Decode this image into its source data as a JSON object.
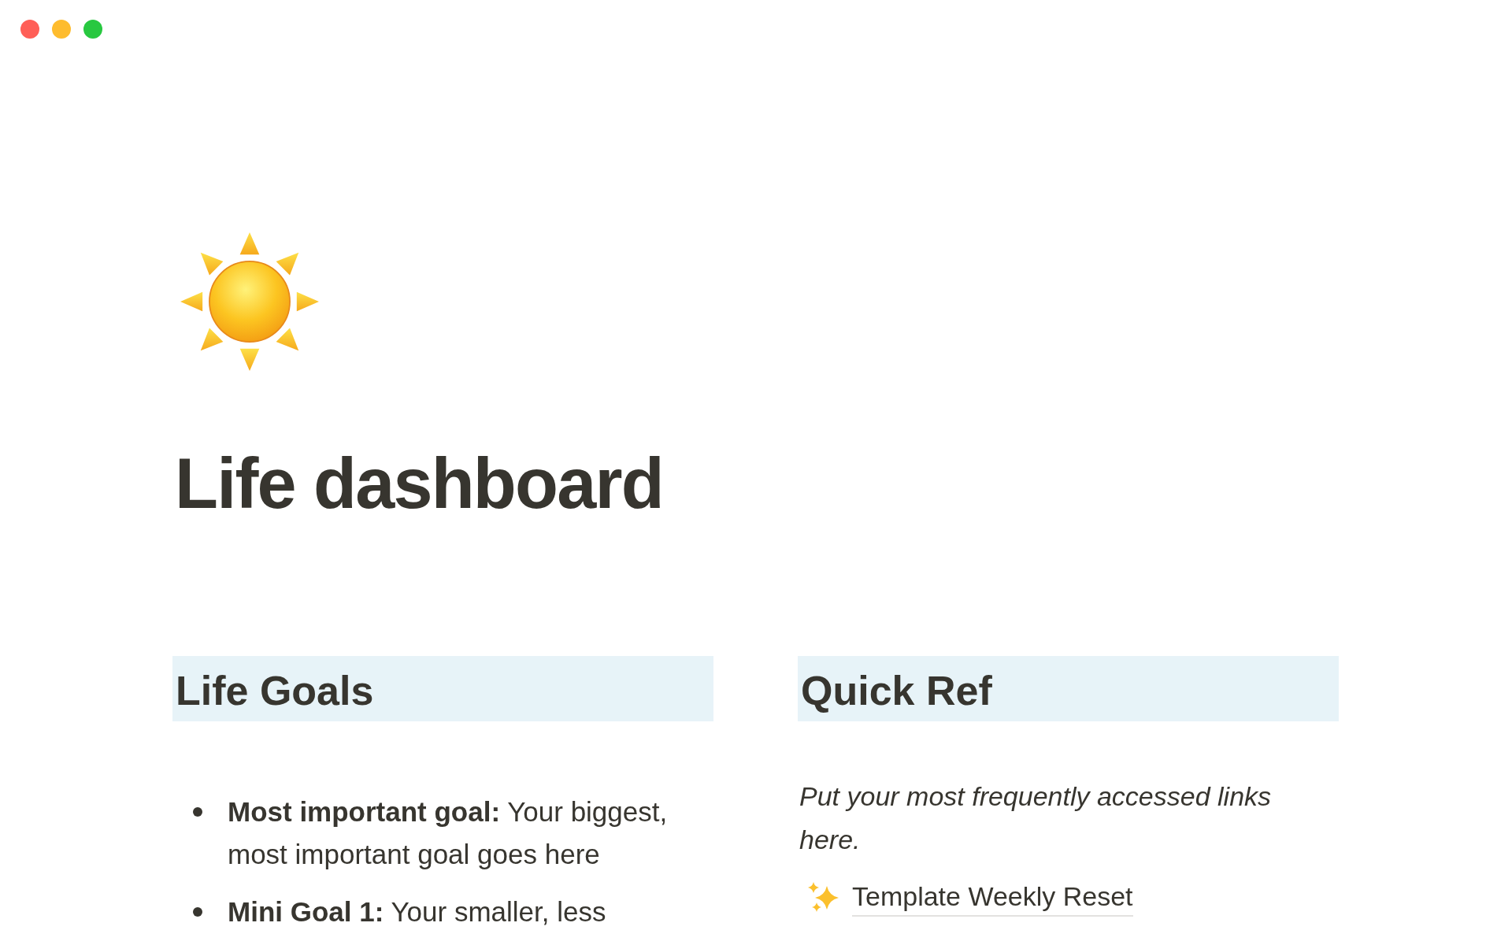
{
  "page": {
    "title": "Life dashboard"
  },
  "sections": [
    {
      "kind": "bullets",
      "heading": "Life Goals",
      "items": [
        "**Most important goal:** Your biggest, most important goal goes here",
        "**Mini Goal 1:** Your smaller, less"
      ]
    },
    {
      "kind": "links",
      "heading": "Quick Ref",
      "note": "Put your most frequently accessed links here.",
      "links": [
        "Template Weekly Reset"
      ]
    }
  ]
}
